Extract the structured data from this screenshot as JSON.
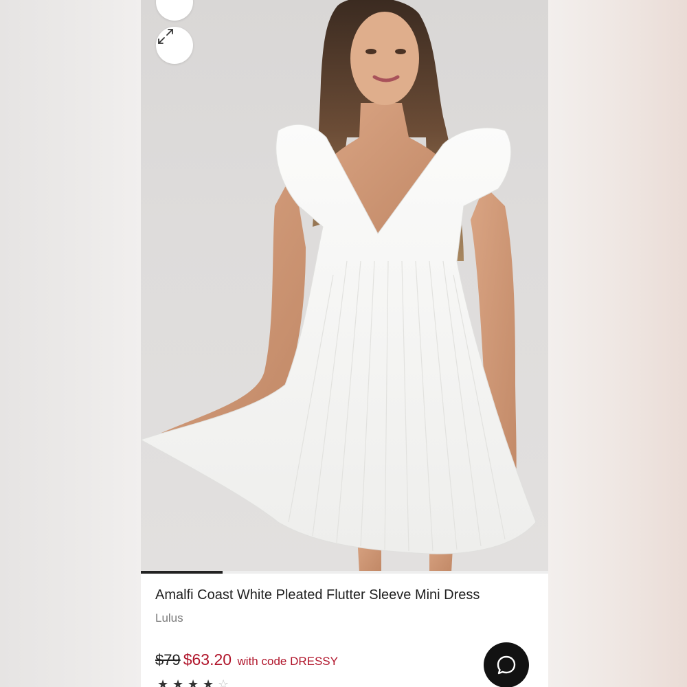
{
  "product": {
    "title": "Amalfi Coast White Pleated Flutter Sleeve Mini Dress",
    "brand": "Lulus",
    "original_price": "$79",
    "sale_price": "$63.20",
    "promo_text": "with code DRESSY",
    "rating_stars": 4,
    "rating_max": 5
  },
  "gallery": {
    "progress_fraction": 0.2
  },
  "icons": {
    "favorite": "heart-icon",
    "expand": "expand-icon",
    "chat": "chat-bubble-icon"
  },
  "colors": {
    "sale_price": "#b0142a",
    "chat_button": "#121212"
  }
}
